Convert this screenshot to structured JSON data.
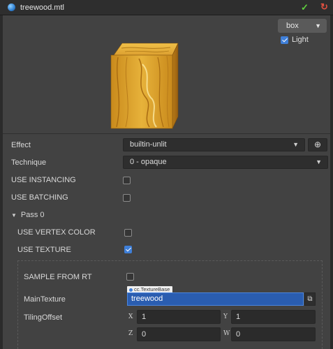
{
  "window": {
    "title": "treewood.mtl",
    "confirm_icon": "check-icon",
    "revert_icon": "revert-icon"
  },
  "preview": {
    "shape_select": {
      "value": "box"
    },
    "light": {
      "label": "Light",
      "checked": true
    },
    "colors": {
      "wood_light": "#e7b23a",
      "wood_dark": "#a86b12"
    }
  },
  "properties": {
    "effect": {
      "label": "Effect",
      "value": "builtin-unlit"
    },
    "technique": {
      "label": "Technique",
      "value": "0 - opaque"
    },
    "use_instancing": {
      "label": "USE INSTANCING",
      "checked": false
    },
    "use_batching": {
      "label": "USE BATCHING",
      "checked": false
    }
  },
  "pass": {
    "header": "Pass 0",
    "use_vertex_color": {
      "label": "USE VERTEX COLOR",
      "checked": false
    },
    "use_texture": {
      "label": "USE TEXTURE",
      "checked": true
    },
    "sample_from_rt": {
      "label": "SAMPLE FROM RT",
      "checked": false
    },
    "main_texture": {
      "label": "MainTexture",
      "type_tag": "cc.TextureBase",
      "value": "treewood"
    },
    "tiling_offset": {
      "label": "TilingOffset",
      "x_label": "X",
      "x": "1",
      "y_label": "Y",
      "y": "1",
      "z_label": "Z",
      "z": "0",
      "w_label": "W",
      "w": "0"
    }
  }
}
